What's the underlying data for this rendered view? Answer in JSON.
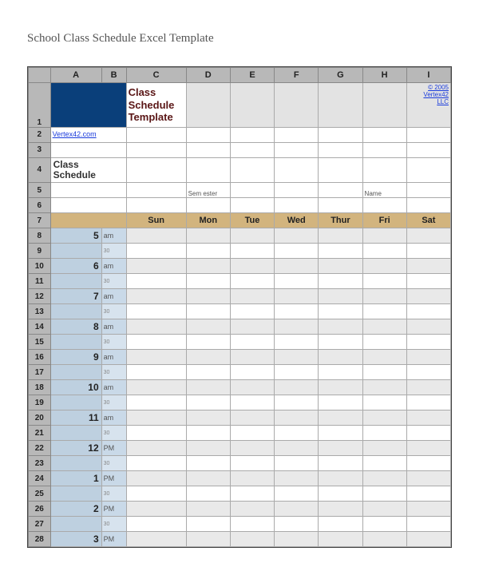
{
  "page": {
    "title": "School Class Schedule Excel Template"
  },
  "spreadsheet": {
    "cols": [
      "A",
      "B",
      "C",
      "D",
      "E",
      "F",
      "G",
      "H",
      "I"
    ],
    "rows": [
      "1",
      "2",
      "3",
      "4",
      "5",
      "6",
      "7",
      "8",
      "9",
      "10",
      "11",
      "12",
      "13",
      "14",
      "15",
      "16",
      "17",
      "18",
      "19",
      "20",
      "21",
      "22",
      "23",
      "24",
      "25",
      "26",
      "27",
      "28"
    ]
  },
  "content": {
    "template_title": "Class Schedule Template",
    "vertex_link": "Vertex42.com",
    "credit1": "© 2005",
    "credit2": "Vertex42",
    "credit3": "LLC",
    "class_schedule_label": "Class Schedule",
    "semester_label": "Sem ester",
    "name_label": "Name",
    "days": [
      "Sun",
      "Mon",
      "Tue",
      "Wed",
      "Thur",
      "Fri",
      "Sat"
    ],
    "times": [
      {
        "h": "5",
        "p": "am"
      },
      {
        "h": "",
        "p": "30"
      },
      {
        "h": "6",
        "p": "am"
      },
      {
        "h": "",
        "p": "30"
      },
      {
        "h": "7",
        "p": "am"
      },
      {
        "h": "",
        "p": "30"
      },
      {
        "h": "8",
        "p": "am"
      },
      {
        "h": "",
        "p": "30"
      },
      {
        "h": "9",
        "p": "am"
      },
      {
        "h": "",
        "p": "30"
      },
      {
        "h": "10",
        "p": "am"
      },
      {
        "h": "",
        "p": "30"
      },
      {
        "h": "11",
        "p": "am"
      },
      {
        "h": "",
        "p": "30"
      },
      {
        "h": "12",
        "p": "PM"
      },
      {
        "h": "",
        "p": "30"
      },
      {
        "h": "1",
        "p": "PM"
      },
      {
        "h": "",
        "p": "30"
      },
      {
        "h": "2",
        "p": "PM"
      },
      {
        "h": "",
        "p": "30"
      },
      {
        "h": "3",
        "p": "PM"
      }
    ]
  }
}
